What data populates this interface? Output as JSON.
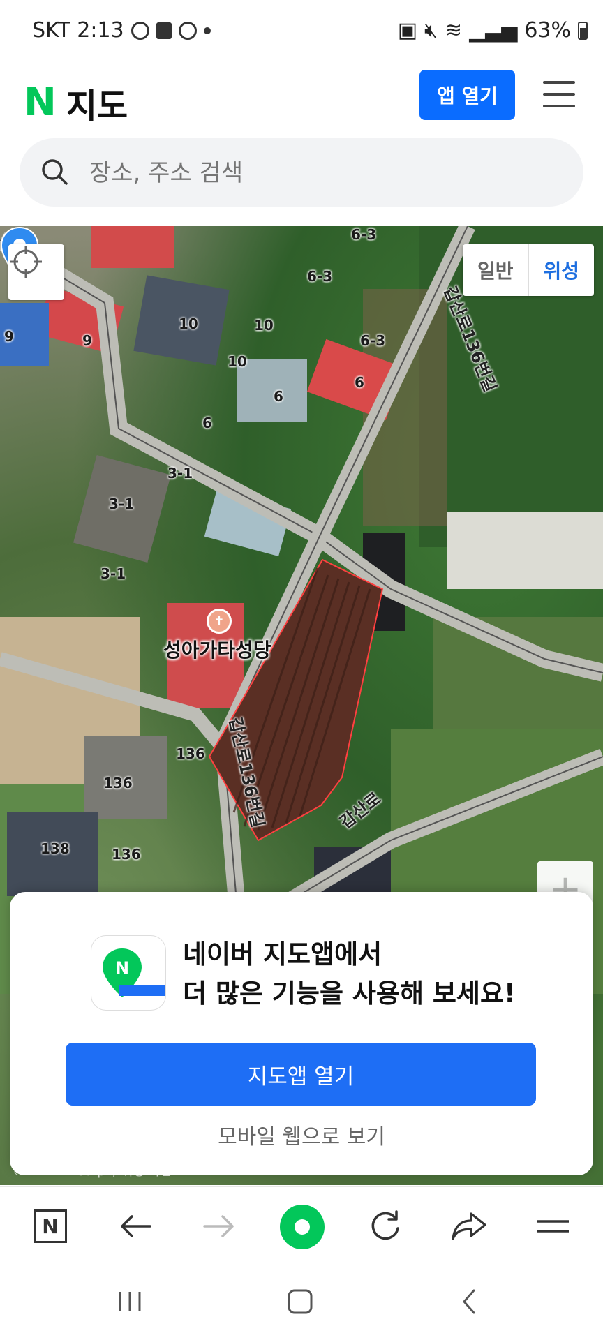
{
  "status_bar": {
    "carrier_time": "SKT 2:13",
    "battery": "63%"
  },
  "header": {
    "logo_mark": "N",
    "logo_text": "지도",
    "open_app_label": "앱 열기"
  },
  "search": {
    "placeholder": "장소, 주소 검색"
  },
  "map": {
    "map_type": {
      "normal": "일반",
      "satellite": "위성",
      "selected": "위성"
    },
    "poi_name": "성아가타성당",
    "road_labels": [
      "갑산로136번길",
      "갑산로136번길",
      "갑산로"
    ],
    "lot_labels": [
      "6-3",
      "6-3",
      "6-3",
      "9",
      "9",
      "10",
      "10",
      "10",
      "6",
      "6",
      "6",
      "3-1",
      "3-1",
      "3-1",
      "136",
      "136",
      "136",
      "138"
    ],
    "copyright": "© NAVER Corp. / 위성 사진"
  },
  "bottom_sheet": {
    "title_line1": "네이버 지도앱에서",
    "title_line2": "더 많은 기능을 사용해 보세요!",
    "primary_button": "지도앱 열기",
    "secondary_link": "모바일 웹으로 보기"
  },
  "browser_toolbar": {
    "home_label": "N"
  },
  "colors": {
    "naver_green": "#03c75a",
    "primary_blue": "#1e6ef5",
    "header_button_blue": "#0a6cff"
  }
}
